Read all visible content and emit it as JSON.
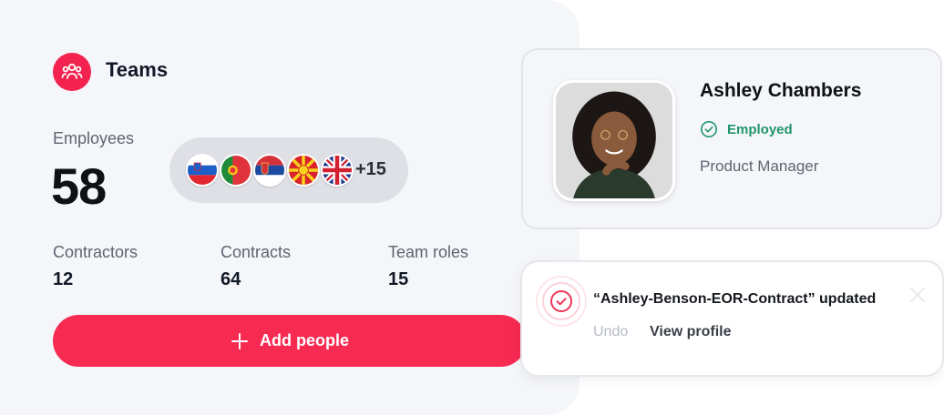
{
  "teams": {
    "title": "Teams",
    "employees_label": "Employees",
    "employees_count": "58",
    "flags": [
      {
        "country": "Slovenia",
        "icon": "slovenia-flag-icon"
      },
      {
        "country": "Portugal",
        "icon": "portugal-flag-icon"
      },
      {
        "country": "Serbia",
        "icon": "serbia-flag-icon"
      },
      {
        "country": "North Macedonia",
        "icon": "macedonia-flag-icon"
      },
      {
        "country": "United Kingdom",
        "icon": "uk-flag-icon"
      }
    ],
    "flags_more": "+15",
    "stats": [
      {
        "label": "Contractors",
        "value": "12"
      },
      {
        "label": "Contracts",
        "value": "64"
      },
      {
        "label": "Team roles",
        "value": "15"
      }
    ],
    "add_button_label": "Add people",
    "accent_color": "#f72a52"
  },
  "profile": {
    "name": "Ashley Chambers",
    "status": "Employed",
    "status_color": "#20956a",
    "role": "Product Manager"
  },
  "toast": {
    "message": "“Ashley-Benson-EOR-Contract” updated",
    "undo_label": "Undo",
    "view_label": "View profile"
  }
}
